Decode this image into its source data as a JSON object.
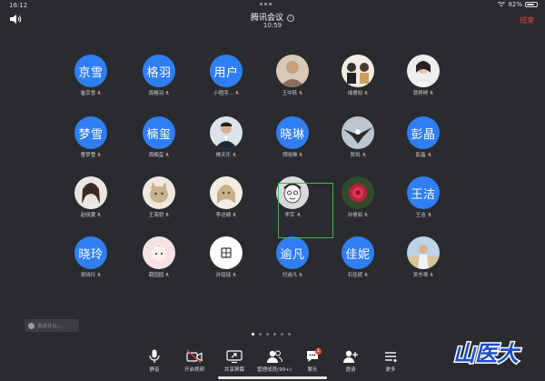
{
  "status_bar": {
    "time": "16:12",
    "battery": "82%",
    "battery_level": 0.82
  },
  "header": {
    "title": "腾讯会议",
    "time": "10:59",
    "end_label": "结束",
    "info_glyph": "i"
  },
  "participants": [
    {
      "avatar_text": "京雪",
      "name": "崔京雪"
    },
    {
      "avatar_text": "格羽",
      "name": "周格羽"
    },
    {
      "avatar_text": "用户",
      "name": "小程序..."
    },
    {
      "avatar_text": "",
      "name": "王中跃",
      "photo": "person-photo"
    },
    {
      "avatar_text": "",
      "name": "成睿如",
      "photo": "group-photo"
    },
    {
      "avatar_text": "",
      "name": "贾婷婷",
      "photo": "girl-photo"
    },
    {
      "avatar_text": "梦雪",
      "name": "曹梦雪"
    },
    {
      "avatar_text": "楠玺",
      "name": "周楠玺"
    },
    {
      "avatar_text": "",
      "name": "杨天乐",
      "photo": "man-suit-photo"
    },
    {
      "avatar_text": "晓琳",
      "name": "郑晓琳"
    },
    {
      "avatar_text": "",
      "name": "贺凯",
      "photo": "eagle-photo"
    },
    {
      "avatar_text": "彭晶",
      "name": "彭晶"
    },
    {
      "avatar_text": "",
      "name": "赵晓雯",
      "photo": "woman-photo"
    },
    {
      "avatar_text": "",
      "name": "王海骄",
      "photo": "cat-photo"
    },
    {
      "avatar_text": "",
      "name": "李达婧",
      "photo": "anime-photo"
    },
    {
      "avatar_text": "",
      "name": "李军",
      "photo": "sketch-face-photo"
    },
    {
      "avatar_text": "",
      "name": "孙倩如",
      "photo": "flower-photo"
    },
    {
      "avatar_text": "王洁",
      "name": "王洁"
    },
    {
      "avatar_text": "晓玲",
      "name": "吴晓玲"
    },
    {
      "avatar_text": "",
      "name": "薛园园",
      "photo": "cartoon-girl-photo"
    },
    {
      "avatar_text": "",
      "name": "孙铭琰",
      "photo": "white-logo-photo"
    },
    {
      "avatar_text": "逾凡",
      "name": "付逾凡"
    },
    {
      "avatar_text": "佳妮",
      "name": "石佳妮"
    },
    {
      "avatar_text": "",
      "name": "吴东琴",
      "photo": "beach-photo"
    }
  ],
  "chat_input": {
    "placeholder": "说点什么..."
  },
  "toolbar": [
    {
      "label": "静音",
      "icon": "microphone-icon"
    },
    {
      "label": "开启视频",
      "icon": "video-off-icon"
    },
    {
      "label": "共享屏幕",
      "icon": "share-screen-icon"
    },
    {
      "label": "管理成员(99+)",
      "icon": "members-icon"
    },
    {
      "label": "聊天",
      "icon": "chat-icon",
      "badge": "1"
    },
    {
      "label": "邀请",
      "icon": "invite-icon"
    },
    {
      "label": "更多",
      "icon": "more-icon"
    }
  ],
  "watermark": {
    "text": "山医大"
  },
  "colors": {
    "background": "#2a2b2e",
    "avatar_blue": "#2f7ef3",
    "end_red": "#e0453a",
    "active_green": "#3fb84c",
    "watermark_blue": "#1d4fc0"
  }
}
